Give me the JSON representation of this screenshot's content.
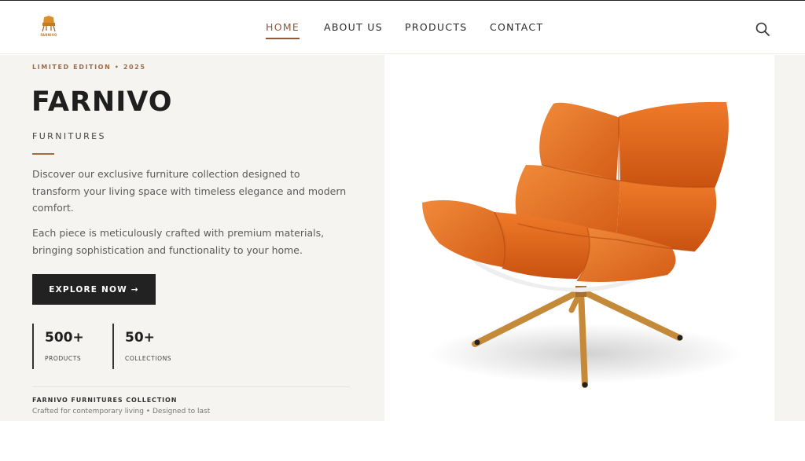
{
  "header": {
    "logo_text": "FARNIVO",
    "nav": [
      {
        "label": "HOME",
        "active": true
      },
      {
        "label": "ABOUT US",
        "active": false
      },
      {
        "label": "PRODUCTS",
        "active": false
      },
      {
        "label": "CONTACT",
        "active": false
      }
    ],
    "search_icon": "search-icon"
  },
  "hero": {
    "eyebrow": "LIMITED EDITION • 2025",
    "brand": "FARNIVO",
    "subtitle": "FURNITURES",
    "paragraph1": "Discover our exclusive furniture collection designed to transform your living space with timeless elegance and modern comfort.",
    "paragraph2": "Each piece is meticulously crafted with premium materials, bringing sophistication and functionality to your home.",
    "cta_label": "EXPLORE NOW →",
    "stats": [
      {
        "value": "500+",
        "label": "PRODUCTS"
      },
      {
        "value": "50+",
        "label": "COLLECTIONS"
      }
    ],
    "footer_title": "FARNIVO FURNITURES COLLECTION",
    "footer_subtitle": "Crafted for contemporary living • Designed to last"
  },
  "colors": {
    "accent": "#a06b45",
    "nav_active": "#8a5a3a",
    "dark": "#222222",
    "hero_bg": "#f5f4f1",
    "chair_orange": "#e0601a",
    "chair_legs": "#c48a3a"
  }
}
